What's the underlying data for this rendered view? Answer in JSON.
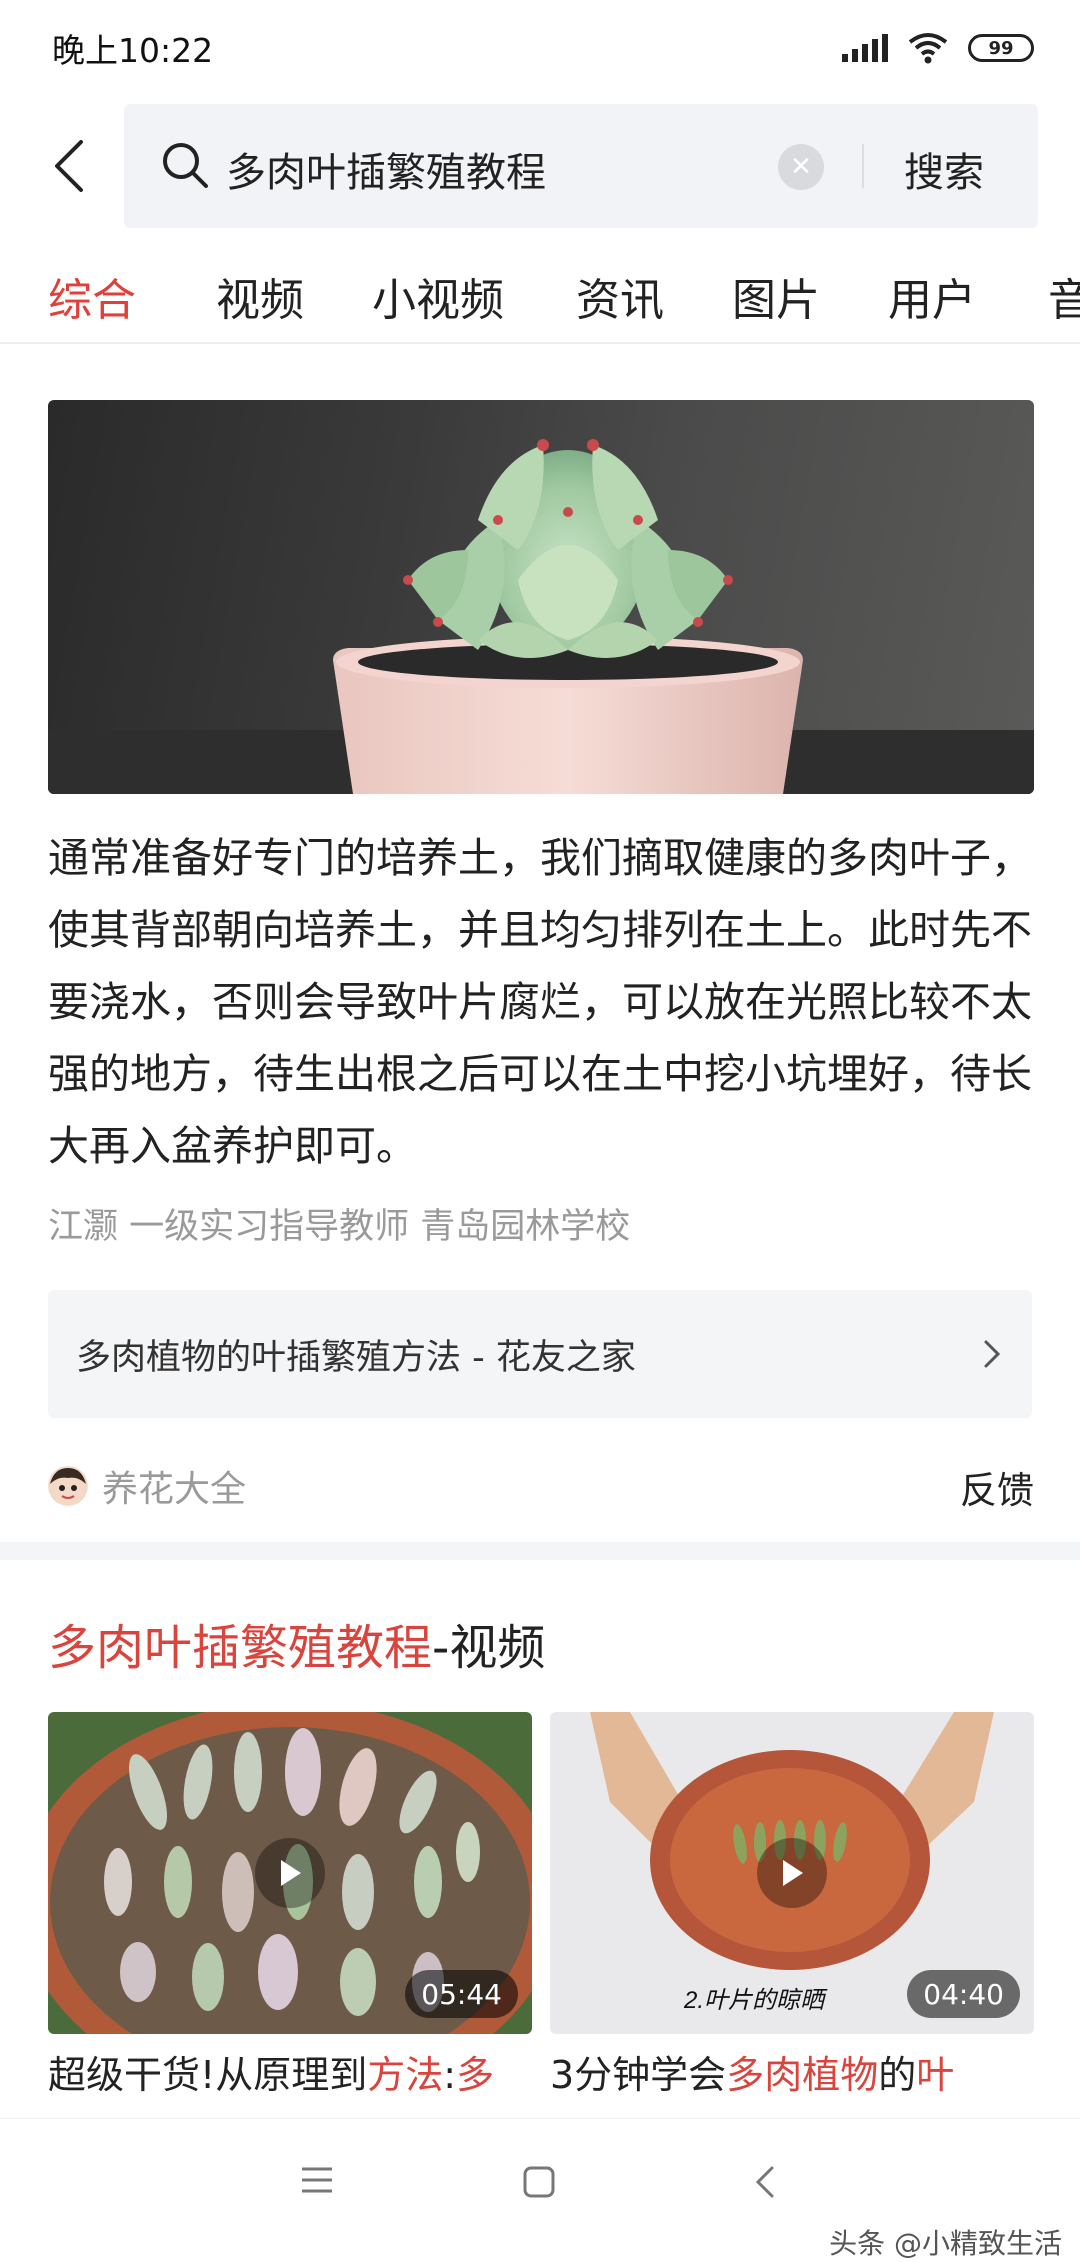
{
  "status": {
    "time": "晚上10:22",
    "battery": "99"
  },
  "search": {
    "query": "多肉叶插繁殖教程",
    "button": "搜索"
  },
  "tabs": [
    {
      "label": "综合",
      "active": true
    },
    {
      "label": "视频"
    },
    {
      "label": "小视频"
    },
    {
      "label": "资讯"
    },
    {
      "label": "图片"
    },
    {
      "label": "用户"
    },
    {
      "label": "音"
    }
  ],
  "result": {
    "text": "通常准备好专门的培养土，我们摘取健康的多肉叶子，使其背部朝向培养土，并且均匀排列在土上。此时先不要浇水，否则会导致叶片腐烂，可以放在光照比较不太强的地方，待生出根之后可以在土中挖小坑埋好，待长大再入盆养护即可。",
    "author": "江灏 一级实习指导教师 青岛园林学校",
    "source_link": "多肉植物的叶插繁殖方法 - 花友之家",
    "source_name": "养花大全",
    "feedback": "反馈"
  },
  "video_section": {
    "title_highlight": "多肉叶插繁殖教程",
    "title_rest": "-视频",
    "videos": [
      {
        "duration": "05:44",
        "caption_parts": [
          "超级干货!从原理到",
          "方法",
          ":",
          "多"
        ],
        "caption_highlight": [
          false,
          true,
          false,
          true
        ]
      },
      {
        "duration": "04:40",
        "overlay_text": "2.叶片的晾晒",
        "caption_parts": [
          "3分钟学会",
          "多肉植物",
          "的",
          "叶"
        ],
        "caption_highlight": [
          false,
          true,
          false,
          true
        ]
      }
    ]
  },
  "watermark": "头条 @小精致生活",
  "colors": {
    "accent": "#e0403a",
    "highlight": "#d9443d",
    "muted": "#9a9a9a",
    "panel": "#f1f3f6"
  }
}
